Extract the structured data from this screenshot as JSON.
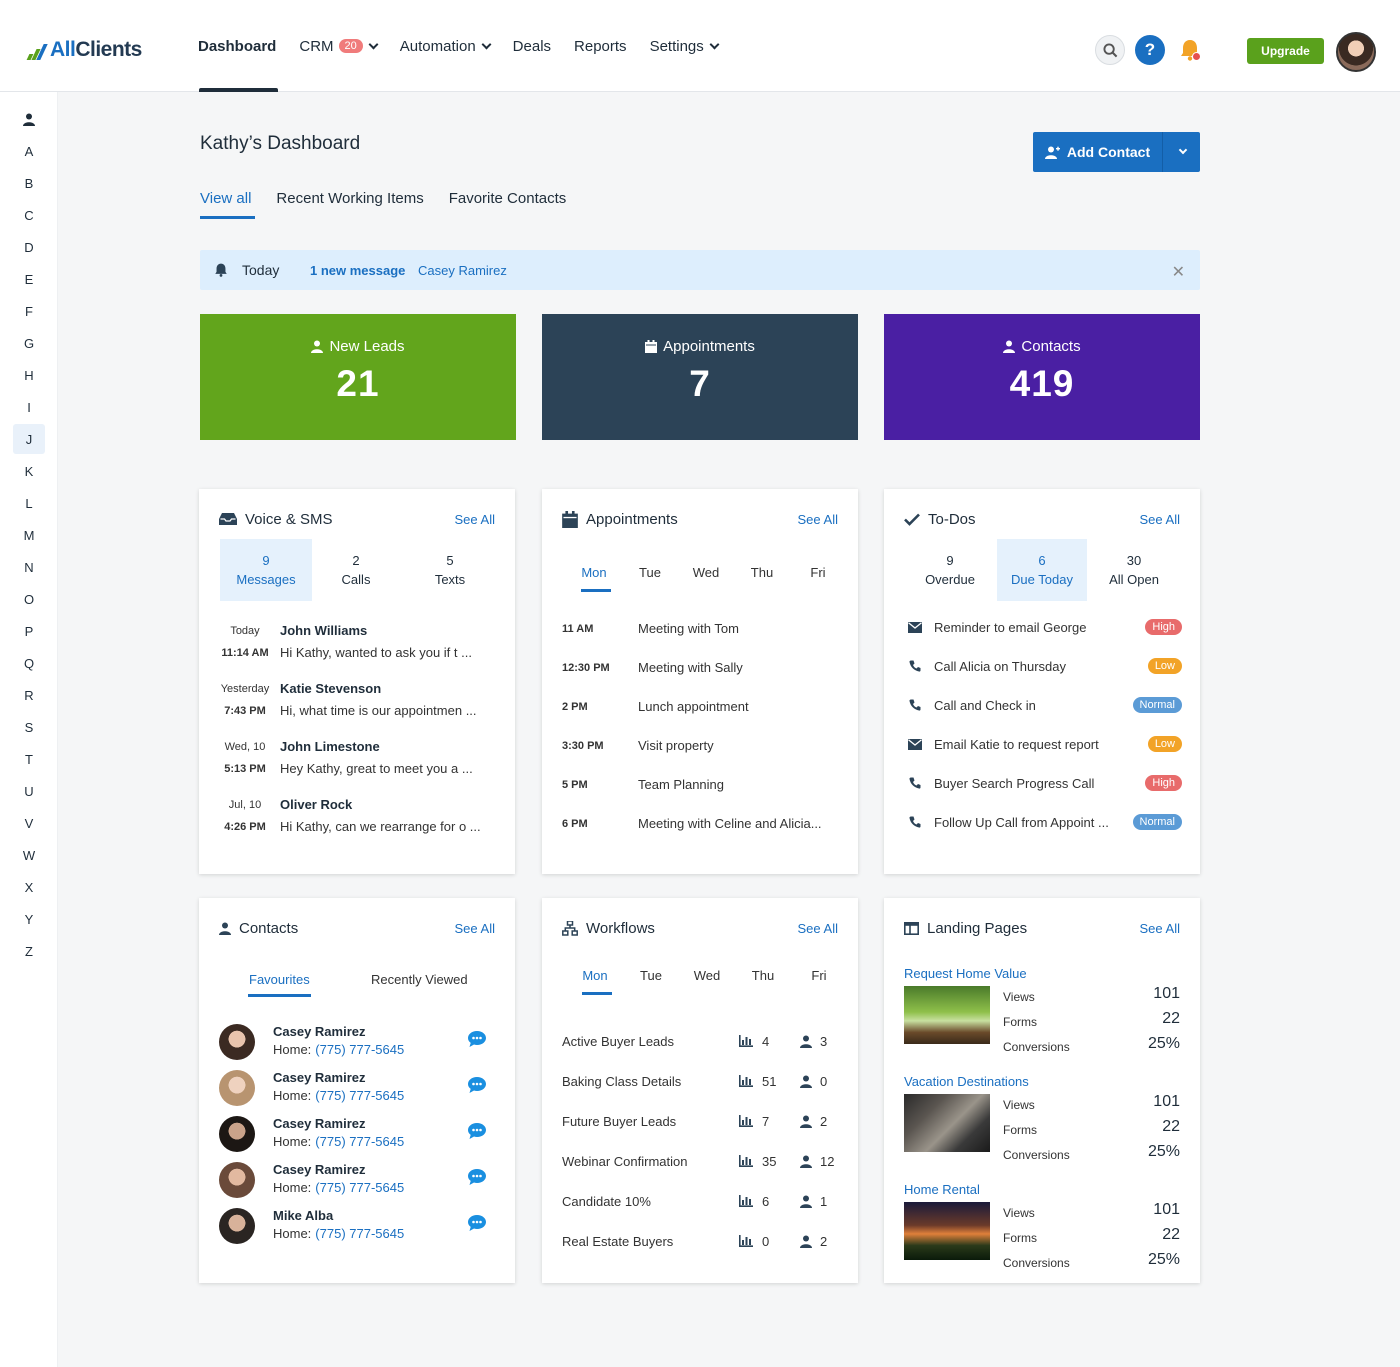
{
  "brand": {
    "name_a": "All",
    "name_b": "Clients"
  },
  "nav": {
    "dashboard": "Dashboard",
    "crm": "CRM",
    "crm_badge": "20",
    "automation": "Automation",
    "deals": "Deals",
    "reports": "Reports",
    "settings": "Settings"
  },
  "top": {
    "help": "?",
    "upgrade": "Upgrade"
  },
  "sidebar": {
    "letters": [
      "A",
      "B",
      "C",
      "D",
      "E",
      "F",
      "G",
      "H",
      "I",
      "J",
      "K",
      "L",
      "M",
      "N",
      "O",
      "P",
      "Q",
      "R",
      "S",
      "T",
      "U",
      "V",
      "W",
      "X",
      "Y",
      "Z"
    ],
    "active": "J"
  },
  "page": {
    "title": "Kathy’s Dashboard",
    "add_contact": "Add Contact",
    "tabs": [
      "View all",
      "Recent Working Items",
      "Favorite Contacts"
    ]
  },
  "notice": {
    "today": "Today",
    "message": "1 new message",
    "who": "Casey Ramirez"
  },
  "stats": [
    {
      "label": "New Leads",
      "value": "21",
      "color": "#62a51c"
    },
    {
      "label": "Appointments",
      "value": "7",
      "color": "#2c4357"
    },
    {
      "label": "Contacts",
      "value": "419",
      "color": "#4a1fa3"
    }
  ],
  "voice": {
    "title": "Voice & SMS",
    "see_all": "See All",
    "segments": [
      {
        "count": "9",
        "label": "Messages"
      },
      {
        "count": "2",
        "label": "Calls"
      },
      {
        "count": "5",
        "label": "Texts"
      }
    ],
    "messages": [
      {
        "date": "Today",
        "time": "11:14 AM",
        "name": "John Williams",
        "text": "Hi Kathy, wanted to ask you if t ..."
      },
      {
        "date": "Yesterday",
        "time": "7:43 PM",
        "name": "Katie Stevenson",
        "text": "Hi, what time is our appointmen ..."
      },
      {
        "date": "Wed, 10",
        "time": "5:13 PM",
        "name": "John Limestone",
        "text": "Hey Kathy, great to meet you a ..."
      },
      {
        "date": "Jul, 10",
        "time": "4:26 PM",
        "name": "Oliver Rock",
        "text": "Hi Kathy, can we rearrange for o ..."
      }
    ]
  },
  "appointments": {
    "title": "Appointments",
    "see_all": "See All",
    "days": [
      "Mon",
      "Tue",
      "Wed",
      "Thu",
      "Fri"
    ],
    "items": [
      {
        "time": "11 AM",
        "what": "Meeting with Tom"
      },
      {
        "time": "12:30 PM",
        "what": "Meeting with Sally"
      },
      {
        "time": "2 PM",
        "what": "Lunch appointment"
      },
      {
        "time": "3:30 PM",
        "what": "Visit property"
      },
      {
        "time": "5 PM",
        "what": "Team Planning"
      },
      {
        "time": "6 PM",
        "what": "Meeting with Celine and Alicia..."
      }
    ]
  },
  "todos": {
    "title": "To-Dos",
    "see_all": "See All",
    "segments": [
      {
        "count": "9",
        "label": "Overdue"
      },
      {
        "count": "6",
        "label": "Due Today"
      },
      {
        "count": "30",
        "label": "All Open"
      }
    ],
    "items": [
      {
        "icon": "envelope-icon",
        "text": "Reminder to email George",
        "priority": "High"
      },
      {
        "icon": "phone-icon",
        "text": "Call Alicia on Thursday",
        "priority": "Low"
      },
      {
        "icon": "phone-icon",
        "text": "Call and Check in",
        "priority": "Normal"
      },
      {
        "icon": "envelope-icon",
        "text": "Email Katie to request report",
        "priority": "Low"
      },
      {
        "icon": "phone-icon",
        "text": " Buyer Search Progress Call",
        "priority": "High"
      },
      {
        "icon": "phone-icon",
        "text": "Follow Up Call from Appoint ...",
        "priority": "Normal"
      }
    ]
  },
  "contacts": {
    "title": "Contacts",
    "see_all": "See All",
    "tabs": [
      "Favourites",
      "Recently Viewed"
    ],
    "home_label": "Home:",
    "items": [
      {
        "name": "Casey Ramirez",
        "phone": "(775) 777-5645"
      },
      {
        "name": "Casey Ramirez",
        "phone": "(775) 777-5645"
      },
      {
        "name": "Casey Ramirez",
        "phone": "(775) 777-5645"
      },
      {
        "name": "Casey Ramirez",
        "phone": "(775) 777-5645"
      },
      {
        "name": "Mike Alba",
        "phone": "(775) 777-5645"
      }
    ]
  },
  "workflows": {
    "title": "Workflows",
    "see_all": "See All",
    "days": [
      "Mon",
      "Tue",
      "Wed",
      "Thu",
      "Fri"
    ],
    "items": [
      {
        "name": "Active Buyer Leads",
        "stats": "4",
        "people": "3"
      },
      {
        "name": "Baking Class Details",
        "stats": "51",
        "people": "0"
      },
      {
        "name": "Future Buyer Leads",
        "stats": "7",
        "people": "2"
      },
      {
        "name": "Webinar Confirmation",
        "stats": "35",
        "people": "12"
      },
      {
        "name": "Candidate 10%",
        "stats": "6",
        "people": "1"
      },
      {
        "name": "Real Estate Buyers",
        "stats": "0",
        "people": "2"
      }
    ]
  },
  "landing": {
    "title": "Landing Pages",
    "see_all": "See All",
    "labels": [
      "Views",
      "Forms",
      "Conversions"
    ],
    "items": [
      {
        "name": "Request Home Value",
        "views": "101",
        "forms": "22",
        "conversions": "25%"
      },
      {
        "name": "Vacation Destinations",
        "views": "101",
        "forms": "22",
        "conversions": "25%"
      },
      {
        "name": "Home Rental",
        "views": "101",
        "forms": "22",
        "conversions": "25%"
      }
    ]
  }
}
